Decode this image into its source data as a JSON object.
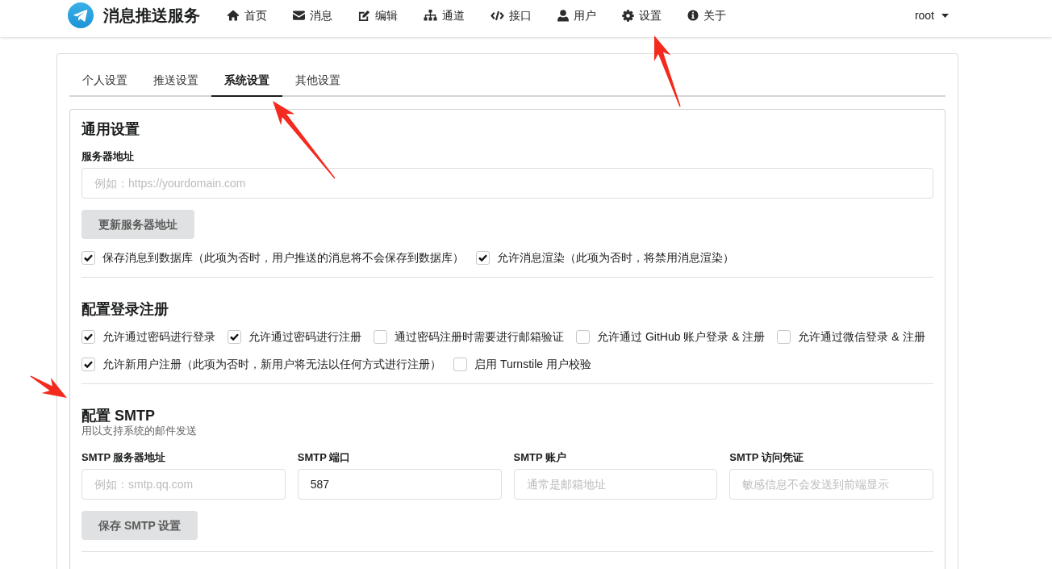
{
  "header": {
    "title": "消息推送服务",
    "nav": [
      {
        "label": "首页"
      },
      {
        "label": "消息"
      },
      {
        "label": "编辑"
      },
      {
        "label": "通道"
      },
      {
        "label": "接口"
      },
      {
        "label": "用户"
      },
      {
        "label": "设置"
      },
      {
        "label": "关于"
      }
    ],
    "user_menu": {
      "label": "root"
    }
  },
  "tabs": [
    {
      "label": "个人设置",
      "selected": false
    },
    {
      "label": "推送设置",
      "selected": false
    },
    {
      "label": "系统设置",
      "selected": true
    },
    {
      "label": "其他设置",
      "selected": false
    }
  ],
  "sections": [
    {
      "title": "通用设置",
      "fields": [
        {
          "label": "服务器地址",
          "placeholder": "例如：https://yourdomain.com"
        }
      ],
      "button": "更新服务器地址",
      "checkbox_rows": [
        {
          "items": [
            {
              "label": "保存消息到数据库（此项为否时，用户推送的消息将不会保存到数据库）",
              "checked": true
            },
            {
              "label": "允许消息渲染（此项为否时，将禁用消息渲染）",
              "checked": true
            }
          ]
        }
      ]
    },
    {
      "title": "配置登录注册",
      "checkbox_rows": [
        {
          "items": [
            {
              "label": "允许通过密码进行登录",
              "checked": true
            },
            {
              "label": "允许通过密码进行注册",
              "checked": true
            },
            {
              "label": "通过密码注册时需要进行邮箱验证",
              "checked": false
            },
            {
              "label": "允许通过 GitHub 账户登录 & 注册",
              "checked": false
            },
            {
              "label": "允许通过微信登录 & 注册",
              "checked": false
            }
          ]
        },
        {
          "items": [
            {
              "label": "允许新用户注册（此项为否时，新用户将无法以任何方式进行注册）",
              "checked": true
            },
            {
              "label": "启用 Turnstile 用户校验",
              "checked": false
            }
          ]
        }
      ]
    },
    {
      "title": "配置 SMTP",
      "subtitle": "用以支持系统的邮件发送",
      "fields": [
        {
          "label": "SMTP 服务器地址",
          "placeholder": "例如：smtp.qq.com"
        },
        {
          "label": "SMTP 端口",
          "value": "587"
        },
        {
          "label": "SMTP 账户",
          "placeholder": "通常是邮箱地址"
        },
        {
          "label": "SMTP 访问凭证",
          "placeholder": "敏感信息不会发送到前端显示"
        }
      ],
      "button": "保存 SMTP 设置"
    }
  ]
}
